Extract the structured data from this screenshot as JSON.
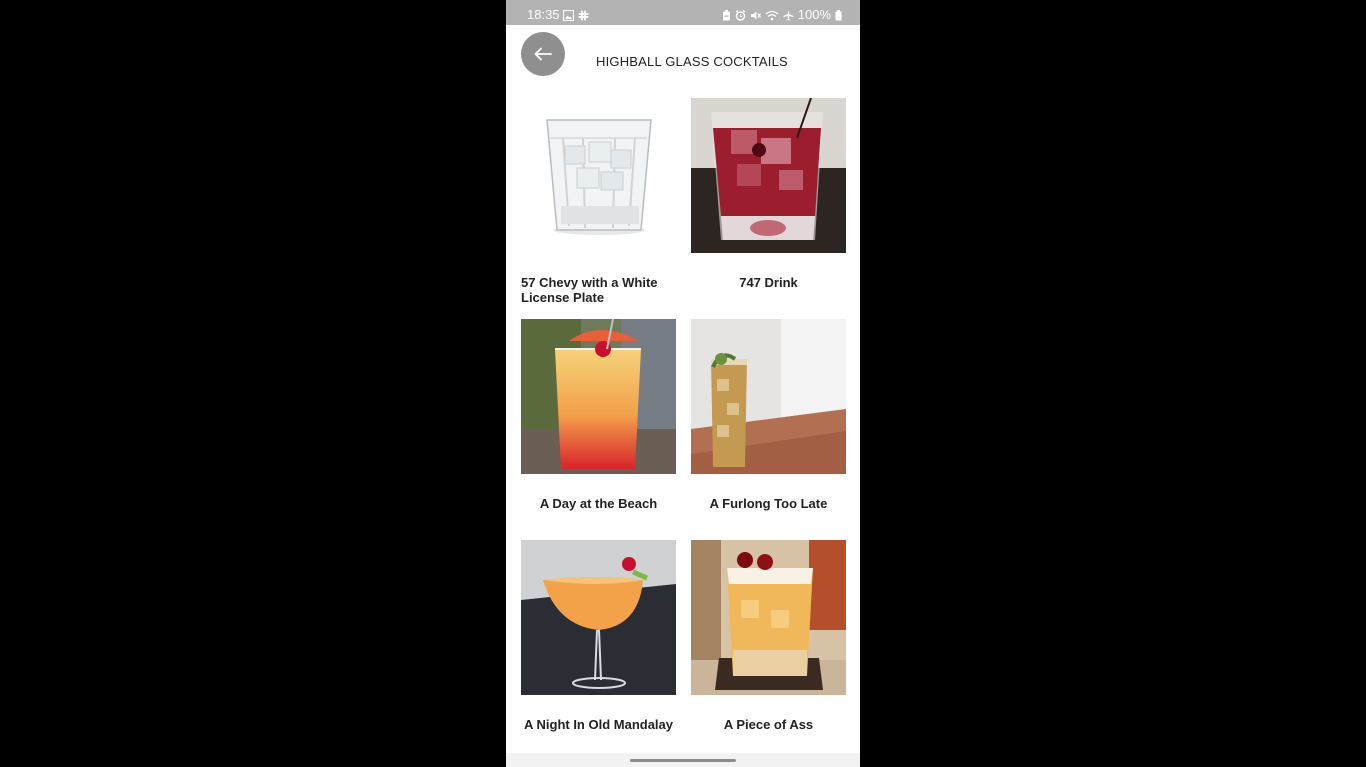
{
  "status_bar": {
    "time": "18:35",
    "battery": "100%",
    "left_icons": [
      "image-icon",
      "slack-icon"
    ],
    "right_icons": [
      "battery-saver-icon",
      "alarm-icon",
      "mute-icon",
      "wifi-icon",
      "airplane-icon",
      "battery-icon"
    ]
  },
  "header": {
    "back_icon": "arrow-left-icon",
    "title": "HIGHBALL GLASS COCKTAILS"
  },
  "cocktails": [
    {
      "name": "57 Chevy with a White License Plate"
    },
    {
      "name": "747 Drink"
    },
    {
      "name": "A Day at the Beach"
    },
    {
      "name": "A Furlong Too Late"
    },
    {
      "name": "A Night In Old Mandalay"
    },
    {
      "name": "A Piece of Ass"
    }
  ],
  "colors": {
    "status_bar_bg": "#b3b3b3",
    "back_button_bg": "#8f8f8f",
    "text": "#222222"
  }
}
